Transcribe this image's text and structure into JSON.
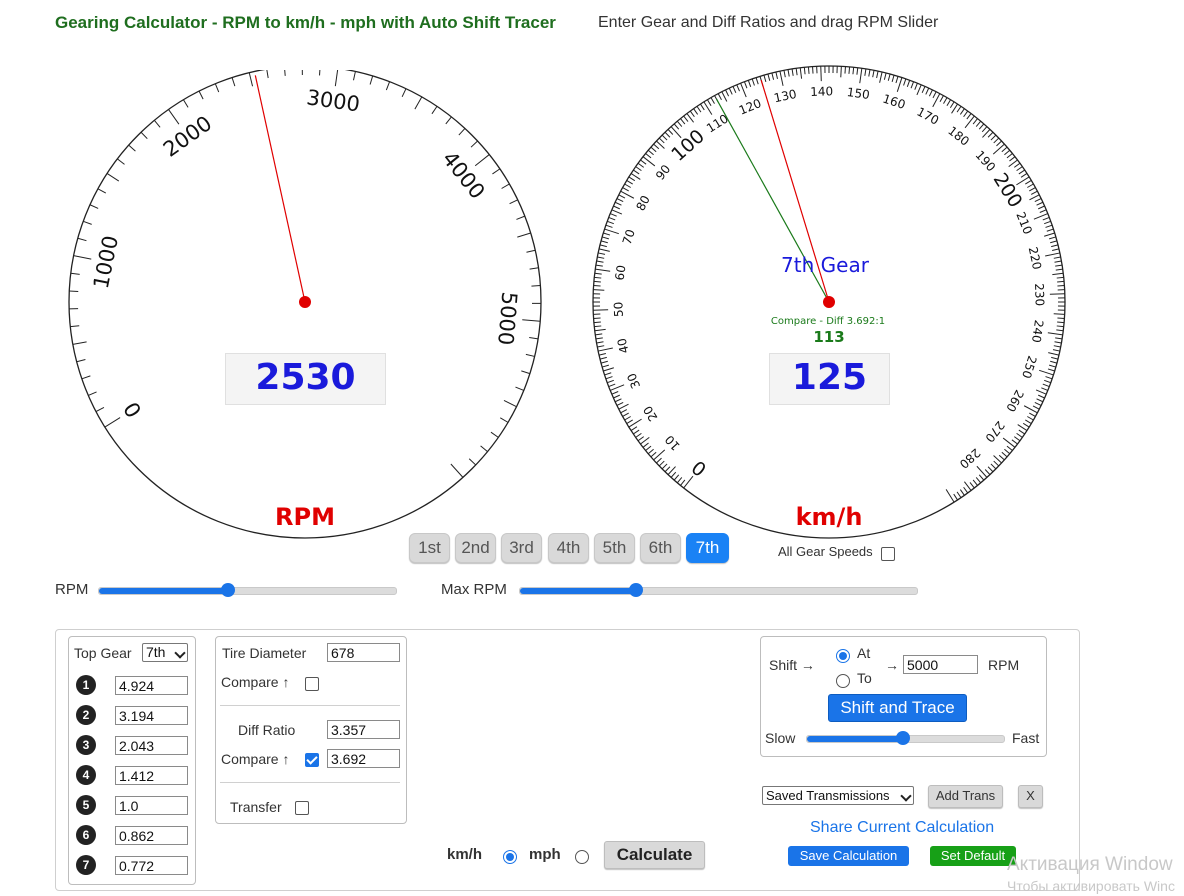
{
  "header": {
    "title": "Gearing Calculator - RPM to km/h - mph with Auto Shift Tracer",
    "subtitle": "Enter Gear and Diff Ratios and drag RPM Slider"
  },
  "rpm_gauge": {
    "unit_label": "RPM",
    "value": "2530",
    "needle_value": 2530,
    "range": [
      0,
      6000
    ],
    "tick_labels": [
      "0",
      "1000",
      "2000",
      "3000",
      "4000",
      "5000"
    ]
  },
  "speed_gauge": {
    "unit_label": "km/h",
    "value": "125",
    "needle_value": 125,
    "compare_needle_value": 113,
    "range": [
      0,
      290
    ],
    "gear_label": "7th Gear",
    "compare_label": "Compare - Diff 3.692:1",
    "compare_value": "113",
    "tick_labels": [
      "0",
      "10",
      "20",
      "30",
      "40",
      "50",
      "60",
      "70",
      "80",
      "90",
      "100",
      "110",
      "120",
      "130",
      "140",
      "150",
      "160",
      "170",
      "180",
      "190",
      "200",
      "210",
      "220",
      "230",
      "240",
      "250",
      "260",
      "270",
      "280"
    ]
  },
  "gear_buttons": [
    "1st",
    "2nd",
    "3rd",
    "4th",
    "5th",
    "6th",
    "7th"
  ],
  "active_gear": "7th",
  "all_gear_speeds_label": "All Gear Speeds",
  "sliders": {
    "rpm_label": "RPM",
    "rpm_fraction": 0.43,
    "max_rpm_label": "Max RPM",
    "max_rpm_fraction": 0.29
  },
  "gears_box": {
    "top_gear_label": "Top Gear",
    "top_gear_value": "7th",
    "ratios": [
      {
        "num": "1",
        "value": "4.924"
      },
      {
        "num": "2",
        "value": "3.194"
      },
      {
        "num": "3",
        "value": "2.043"
      },
      {
        "num": "4",
        "value": "1.412"
      },
      {
        "num": "5",
        "value": "1.0"
      },
      {
        "num": "6",
        "value": "0.862"
      },
      {
        "num": "7",
        "value": "0.772"
      }
    ]
  },
  "tire_box": {
    "tire_diameter_label": "Tire Diameter",
    "tire_diameter_value": "678",
    "compare_label": "Compare ↑",
    "diff_ratio_label": "Diff Ratio",
    "diff_ratio_value": "3.357",
    "diff_compare_label": "Compare ↑",
    "diff_compare_value": "3.692",
    "transfer_label": "Transfer"
  },
  "units": {
    "kmh_label": "km/h",
    "mph_label": "mph",
    "calculate_label": "Calculate"
  },
  "shift_box": {
    "shift_label": "Shift →",
    "at_label": "At",
    "to_label": "To",
    "arrow": "→",
    "rpm_value": "5000",
    "rpm_label": "RPM",
    "shift_trace_label": "Shift and Trace",
    "slow_label": "Slow",
    "fast_label": "Fast",
    "speed_fraction": 0.48
  },
  "saved": {
    "select_label": "Saved Transmissions",
    "add_trans_label": "Add Trans",
    "close_label": "X",
    "share_label": "Share Current Calculation",
    "save_label": "Save Calculation",
    "set_default_label": "Set Default"
  },
  "watermark": {
    "line1": "Активация Window",
    "line2": "Чтобы активировать Winc"
  },
  "colors": {
    "title": "#1f6e1f",
    "readout": "#1a1adb",
    "unit_label": "#e00000",
    "needle": "#e00000",
    "compare": "#1a7a1a",
    "accent": "#1a74e8"
  }
}
